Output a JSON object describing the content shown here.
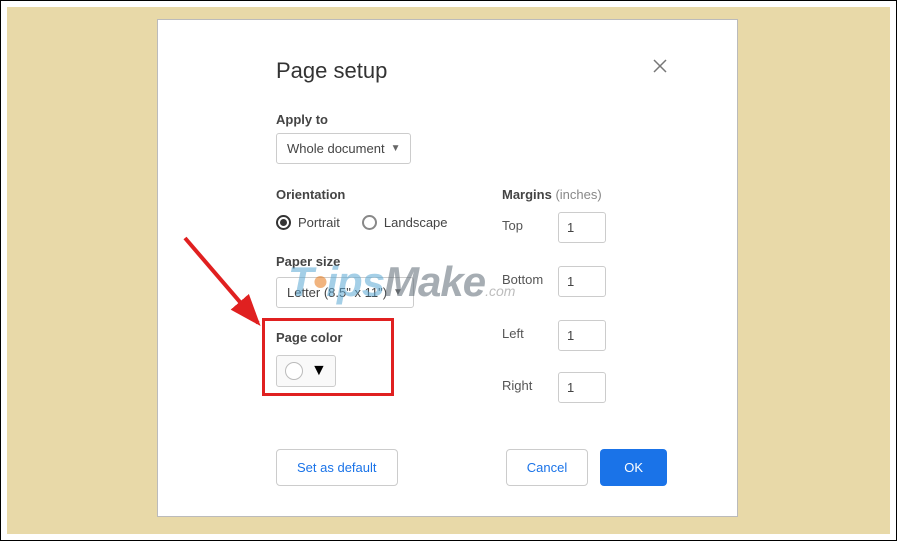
{
  "dialog": {
    "title": "Page setup",
    "applyTo": {
      "label": "Apply to",
      "value": "Whole document"
    },
    "orientation": {
      "label": "Orientation",
      "portrait": "Portrait",
      "landscape": "Landscape"
    },
    "paperSize": {
      "label": "Paper size",
      "value": "Letter (8.5\" x 11\")"
    },
    "pageColor": {
      "label": "Page color"
    },
    "margins": {
      "label": "Margins",
      "unit": "(inches)",
      "top": {
        "label": "Top",
        "value": "1"
      },
      "bottom": {
        "label": "Bottom",
        "value": "1"
      },
      "left": {
        "label": "Left",
        "value": "1"
      },
      "right": {
        "label": "Right",
        "value": "1"
      }
    },
    "buttons": {
      "setDefault": "Set as default",
      "cancel": "Cancel",
      "ok": "OK"
    }
  },
  "watermark": {
    "part1": "T",
    "part2": "ips",
    "part3": "Make",
    "part4": ".com"
  }
}
